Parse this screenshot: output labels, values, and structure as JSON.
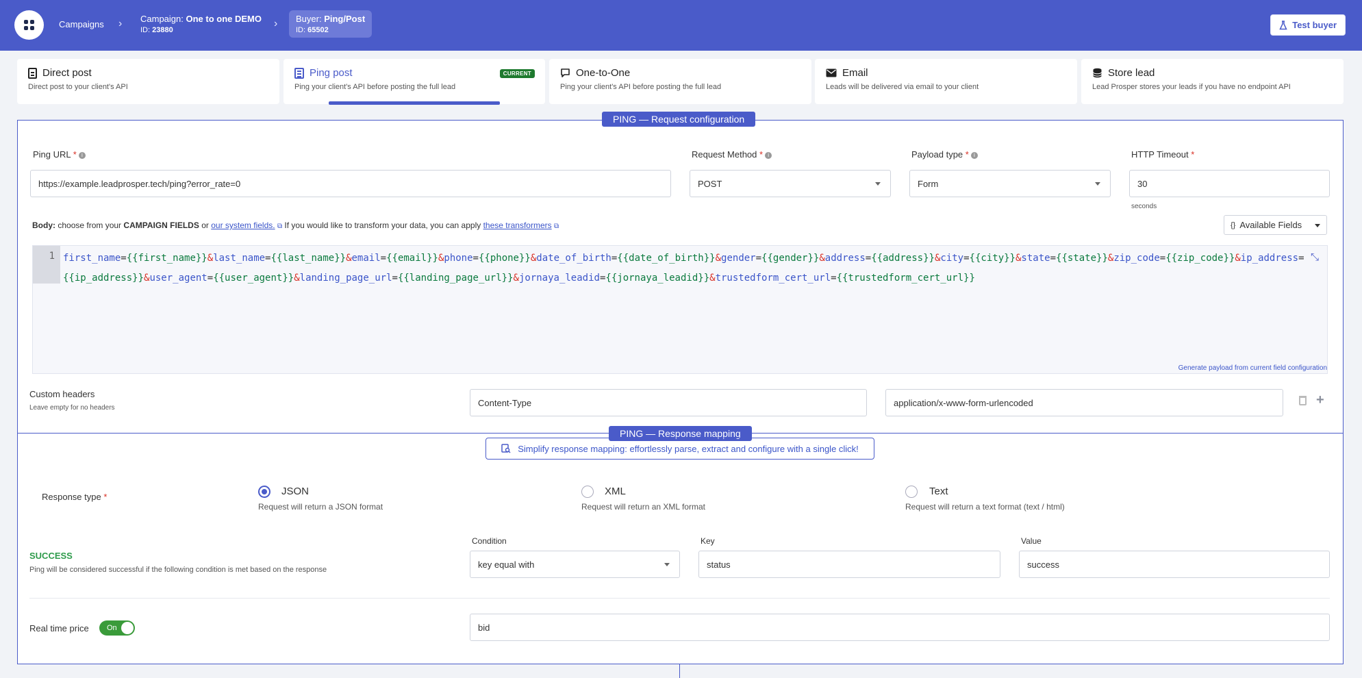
{
  "breadcrumb": {
    "campaigns_label": "Campaigns",
    "campaign_prefix": "Campaign:",
    "campaign_name": "One to one DEMO",
    "campaign_id_label": "ID:",
    "campaign_id": "23880",
    "buyer_prefix": "Buyer:",
    "buyer_name": "Ping/Post",
    "buyer_id_label": "ID:",
    "buyer_id": "65502"
  },
  "header": {
    "test_buyer_label": "Test buyer"
  },
  "tabs": [
    {
      "title": "Direct post",
      "desc": "Direct post to your client's API"
    },
    {
      "title": "Ping post",
      "desc": "Ping your client's API before posting the full lead",
      "badge": "CURRENT"
    },
    {
      "title": "One-to-One",
      "desc": "Ping your client's API before posting the full lead"
    },
    {
      "title": "Email",
      "desc": "Leads will be delivered via email to your client"
    },
    {
      "title": "Store lead",
      "desc": "Lead Prosper stores your leads if you have no endpoint API"
    }
  ],
  "request": {
    "section_title": "PING — Request configuration",
    "ping_url_label": "Ping URL",
    "ping_url_value": "https://example.leadprosper.tech/ping?error_rate=0",
    "method_label": "Request Method",
    "method_value": "POST",
    "payload_label": "Payload type",
    "payload_value": "Form",
    "timeout_label": "HTTP Timeout",
    "timeout_value": "30",
    "timeout_unit": "seconds",
    "body_label": "Body:",
    "body_text1": "choose from your",
    "body_campaign_fields": "CAMPAIGN FIELDS",
    "body_or": "or",
    "body_system_fields": "our system fields.",
    "body_text2": "If you would like to transform your data, you can apply",
    "body_transformers": "these transformers",
    "available_fields_label": "Available Fields",
    "line_number": "1",
    "generate_link": "Generate payload from current field configuration",
    "custom_headers_label": "Custom headers",
    "custom_headers_hint": "Leave empty for no headers",
    "header_key": "Content-Type",
    "header_value": "application/x-www-form-urlencoded"
  },
  "body_params": [
    {
      "key": "first_name",
      "value": "{{first_name}}"
    },
    {
      "key": "last_name",
      "value": "{{last_name}}"
    },
    {
      "key": "email",
      "value": "{{email}}"
    },
    {
      "key": "phone",
      "value": "{{phone}}"
    },
    {
      "key": "date_of_birth",
      "value": "{{date_of_birth}}"
    },
    {
      "key": "gender",
      "value": "{{gender}}"
    },
    {
      "key": "address",
      "value": "{{address}}"
    },
    {
      "key": "city",
      "value": "{{city}}"
    },
    {
      "key": "state",
      "value": "{{state}}"
    },
    {
      "key": "zip_code",
      "value": "{{zip_code}}"
    },
    {
      "key": "ip_address",
      "value": "{{ip_address}}"
    },
    {
      "key": "user_agent",
      "value": "{{user_agent}}"
    },
    {
      "key": "landing_page_url",
      "value": "{{landing_page_url}}"
    },
    {
      "key": "jornaya_leadid",
      "value": "{{jornaya_leadid}}"
    },
    {
      "key": "trustedform_cert_url",
      "value": "{{trustedform_cert_url}}"
    }
  ],
  "response": {
    "section_title": "PING — Response mapping",
    "simplify_text": "Simplify response mapping: effortlessly parse, extract and configure with a single click!",
    "type_label": "Response type",
    "options": [
      {
        "label": "JSON",
        "desc": "Request will return a JSON format",
        "selected": true
      },
      {
        "label": "XML",
        "desc": "Request will return an XML format",
        "selected": false
      },
      {
        "label": "Text",
        "desc": "Request will return a text format (text / html)",
        "selected": false
      }
    ],
    "success_title": "SUCCESS",
    "success_desc": "Ping will be considered successful if the following condition is met based on the response",
    "condition_label": "Condition",
    "condition_value": "key equal with",
    "key_label": "Key",
    "key_value": "status",
    "value_label": "Value",
    "value_value": "success",
    "realtime_label": "Real time price",
    "realtime_toggle": "On",
    "realtime_value": "bid"
  },
  "colors": {
    "primary": "#4a5bc9",
    "success": "#2e9b4b",
    "badge": "#1e7a2e",
    "required": "#d93025"
  }
}
